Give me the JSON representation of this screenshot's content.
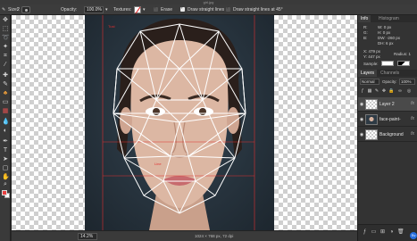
{
  "window": {
    "filename": "girl.jpg"
  },
  "options_bar": {
    "size_label": "Size:",
    "size_value": "2",
    "opacity_label": "Opacity:",
    "opacity_value": "100.0%",
    "textures_label": "Textures:",
    "erase_label": "Erase",
    "straight_lines_label": "Draw straight lines",
    "straight_45_label": "Draw straight lines at 45°"
  },
  "toolbar": {
    "tools": [
      "move",
      "marquee",
      "lasso",
      "wand",
      "crop",
      "eyedropper",
      "heal",
      "brush",
      "clone",
      "eraser",
      "gradient",
      "blur",
      "dodge",
      "pen",
      "text",
      "path",
      "shape",
      "hand",
      "zoom"
    ],
    "foreground_color": "#e84040",
    "background_color": "#ffffff"
  },
  "canvas": {
    "guide_label_left": "Tust",
    "guide_label_mid": "Line",
    "overlay_color": "#ffffff",
    "guide_color": "#e03030"
  },
  "status": {
    "zoom": "14.2%",
    "doc_info": "1024 × 768 px, 72 dpi"
  },
  "panels": {
    "top_tabs": [
      "Info",
      "Histogram"
    ],
    "info": {
      "rows": [
        {
          "label": "R:",
          "value": ""
        },
        {
          "label": "G:",
          "value": ""
        },
        {
          "label": "B:",
          "value": ""
        },
        {
          "label": "W:",
          "value": "0 px"
        },
        {
          "label": "H:",
          "value": "0 px"
        },
        {
          "label": "DW:",
          "value": "-260 px"
        },
        {
          "label": "DH:",
          "value": "6 px"
        },
        {
          "label": "X:",
          "value": "479 px"
        },
        {
          "label": "Y:",
          "value": "447 px"
        }
      ],
      "radius_label": "Radius:",
      "radius_value": "1",
      "sample_label": "Sample:"
    },
    "layer_tabs": [
      "Layers",
      "Channels"
    ],
    "blend_mode": "Normal",
    "opacity_label": "Opacity:",
    "opacity_value": "100%",
    "layers": [
      {
        "name": "Layer 2",
        "fx": "fx",
        "thumb": "transparent",
        "selected": true
      },
      {
        "name": "face-paint-",
        "fx": "fx",
        "thumb": "face",
        "selected": false
      },
      {
        "name": "Background",
        "fx": "fx",
        "thumb": "transparent",
        "selected": false
      }
    ],
    "badge": "Sv"
  }
}
